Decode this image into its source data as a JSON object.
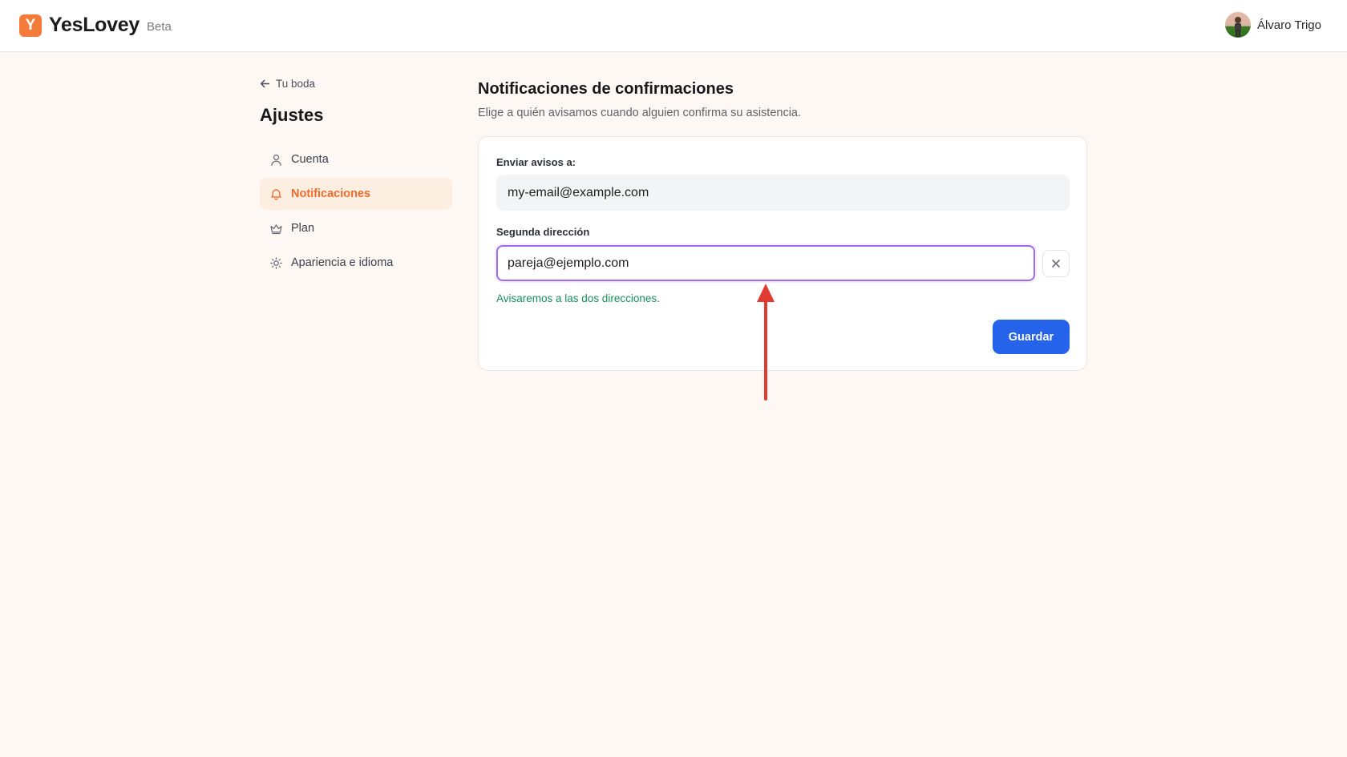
{
  "header": {
    "logo_letter": "Y",
    "brand": "YesLovey",
    "badge": "Beta",
    "user_name": "Álvaro Trigo"
  },
  "sidebar": {
    "back_label": "Tu boda",
    "title": "Ajustes",
    "items": [
      {
        "label": "Cuenta",
        "icon": "user-icon",
        "active": false
      },
      {
        "label": "Notificaciones",
        "icon": "bell-icon",
        "active": true
      },
      {
        "label": "Plan",
        "icon": "crown-icon",
        "active": false
      },
      {
        "label": "Apariencia e idioma",
        "icon": "sun-icon",
        "active": false
      }
    ]
  },
  "main": {
    "title": "Notificaciones de confirmaciones",
    "subtitle": "Elige a quién avisamos cuando alguien confirma su asistencia.",
    "primary": {
      "label": "Enviar avisos a:",
      "value": "my-email@example.com"
    },
    "secondary": {
      "label": "Segunda dirección",
      "value": "pareja@ejemplo.com"
    },
    "hint": "Avisaremos a las dos direcciones.",
    "save_label": "Guardar"
  },
  "colors": {
    "accent": "#f06a2a",
    "primary_button": "#2563eb",
    "focus_ring": "#a06bf0",
    "success_text": "#14925a",
    "annotation_arrow": "#e03a32"
  }
}
